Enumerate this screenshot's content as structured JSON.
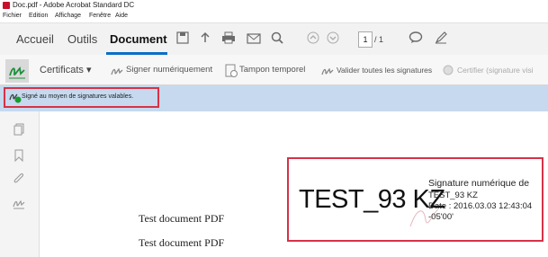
{
  "window": {
    "title": "Doc.pdf - Adobe Acrobat Standard DC"
  },
  "menu": [
    "Fichier",
    "Edition",
    "Affichage",
    "Fenêtre",
    "Aide"
  ],
  "tabs": [
    "Accueil",
    "Outils",
    "Document"
  ],
  "active_tab": "Document",
  "toolbar": {
    "page_current": "1",
    "page_count": "/ 1",
    "icons": [
      "save-icon",
      "upload-icon",
      "print-icon",
      "email-icon",
      "search-icon",
      "page-up-icon",
      "page-down-icon",
      "comment-icon",
      "pen-icon"
    ]
  },
  "signature_toolbar": {
    "certificates": "Certificats ▾",
    "sign_digitally": "Signer numériquement",
    "timestamp": "Tampon temporel",
    "validate_all": "Valider toutes les signatures",
    "certify": "Certifier (signature visi"
  },
  "message_bar": {
    "text": "Signé au moyen de signatures valables."
  },
  "document": {
    "lines": [
      "Test document PDF",
      "Test document PDF"
    ]
  },
  "signature": {
    "name": "TEST_93 KZ",
    "label": "Signature numérique de",
    "signer": "TEST_93 KZ",
    "date": "Date : 2016.03.03 12:43:04",
    "tz": "-05'00'"
  },
  "colors": {
    "accent": "#0b6ec6",
    "highlight": "#d63246",
    "message_bg": "#c6d9ee",
    "signed_icon": "#1a9b2e"
  }
}
